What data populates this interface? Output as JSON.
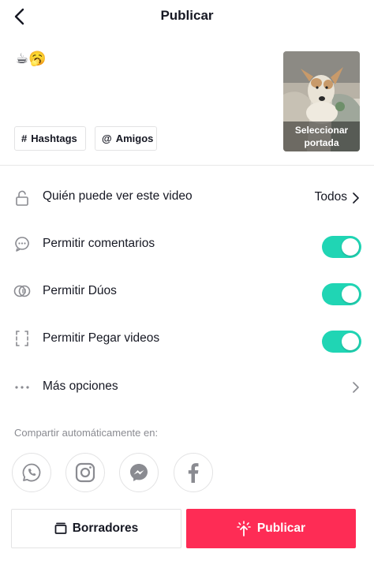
{
  "header": {
    "title": "Publicar"
  },
  "caption": {
    "text": "☕🥱"
  },
  "chips": {
    "hashtags_symbol": "#",
    "hashtags": "Hashtags",
    "amigos_symbol": "@",
    "amigos": "Amigos"
  },
  "cover": {
    "label_line1": "Seleccionar",
    "label_line2": "portada"
  },
  "settings": {
    "visibility": {
      "label": "Quién puede ver este video",
      "value": "Todos"
    },
    "comments": {
      "label": "Permitir comentarios",
      "enabled": true
    },
    "duets": {
      "label": "Permitir Dúos",
      "enabled": true
    },
    "stitch": {
      "label": "Permitir Pegar videos",
      "enabled": true
    },
    "more": {
      "label": "Más opciones"
    }
  },
  "share": {
    "label": "Compartir automáticamente en:",
    "targets": [
      "whatsapp-icon",
      "instagram-icon",
      "messenger-icon",
      "facebook-icon"
    ]
  },
  "actions": {
    "drafts": "Borradores",
    "publish": "Publicar"
  },
  "colors": {
    "accent": "#fe2c55",
    "toggle_on": "#20d5b4",
    "share_icon": "#8a8b91"
  }
}
